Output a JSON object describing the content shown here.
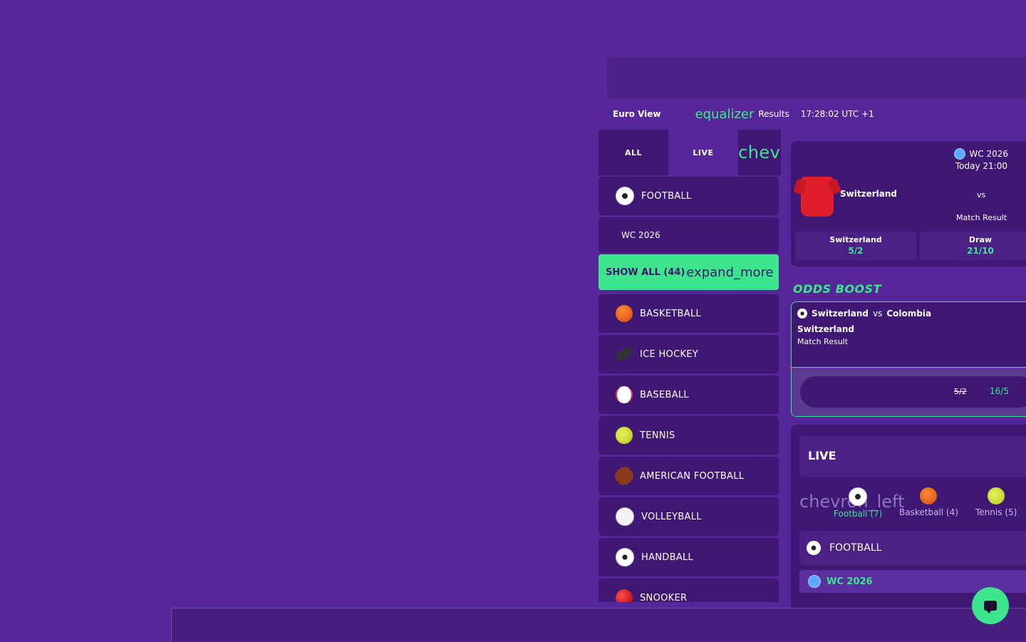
{
  "toolbar": {
    "euro_icon": "",
    "euro_label": "Euro View",
    "square_icon": "",
    "equalizer_label": "equalizer",
    "results_label": "Results",
    "clock": "17:28:02 UTC +1"
  },
  "tabs": {
    "all": "ALL",
    "live": "LIVE",
    "chev": "chev"
  },
  "sidebar": {
    "football": "FOOTBALL",
    "wc": "WC 2026",
    "show_all": "SHOW ALL (44)",
    "expand": "expand_more",
    "sports": [
      {
        "label": "BASKETBALL",
        "icon": "basketball-icon"
      },
      {
        "label": "ICE HOCKEY",
        "icon": "ice-hockey-icon"
      },
      {
        "label": "BASEBALL",
        "icon": "baseball-icon"
      },
      {
        "label": "TENNIS",
        "icon": "tennis-icon"
      },
      {
        "label": "AMERICAN FOOTBALL",
        "icon": "american-football-icon"
      },
      {
        "label": "VOLLEYBALL",
        "icon": "volleyball-icon"
      },
      {
        "label": "HANDBALL",
        "icon": "handball-icon"
      },
      {
        "label": "SNOOKER",
        "icon": "snooker-icon"
      }
    ]
  },
  "match": {
    "competition": "WC 2026",
    "time": "Today 21:00",
    "team": "Switzerland",
    "vs": "vs",
    "market": "Match Result",
    "odds": [
      {
        "name": "Switzerland",
        "value": "5/2"
      },
      {
        "name": "Draw",
        "value": "21/10"
      }
    ]
  },
  "boost": {
    "title": "ODDS BOOST",
    "home": "Switzerland",
    "vs": "vs",
    "away": "Colombia",
    "selection": "Switzerland",
    "market": "Match Result",
    "old_price": "5/2",
    "arrow": "",
    "new_price": "16/5"
  },
  "live": {
    "title": "LIVE",
    "chevron": "chevron_left",
    "sports": [
      {
        "label": "Football (7)",
        "icon": "football-icon",
        "active": true
      },
      {
        "label": "Basketball (4)",
        "icon": "basketball-icon"
      },
      {
        "label": "Tennis (5)",
        "icon": "tennis-icon"
      }
    ],
    "football": "FOOTBALL",
    "wc": "WC 2026"
  },
  "colors": {
    "background": "#57279a",
    "panel": "#3e1874",
    "accent": "#3de58e"
  }
}
